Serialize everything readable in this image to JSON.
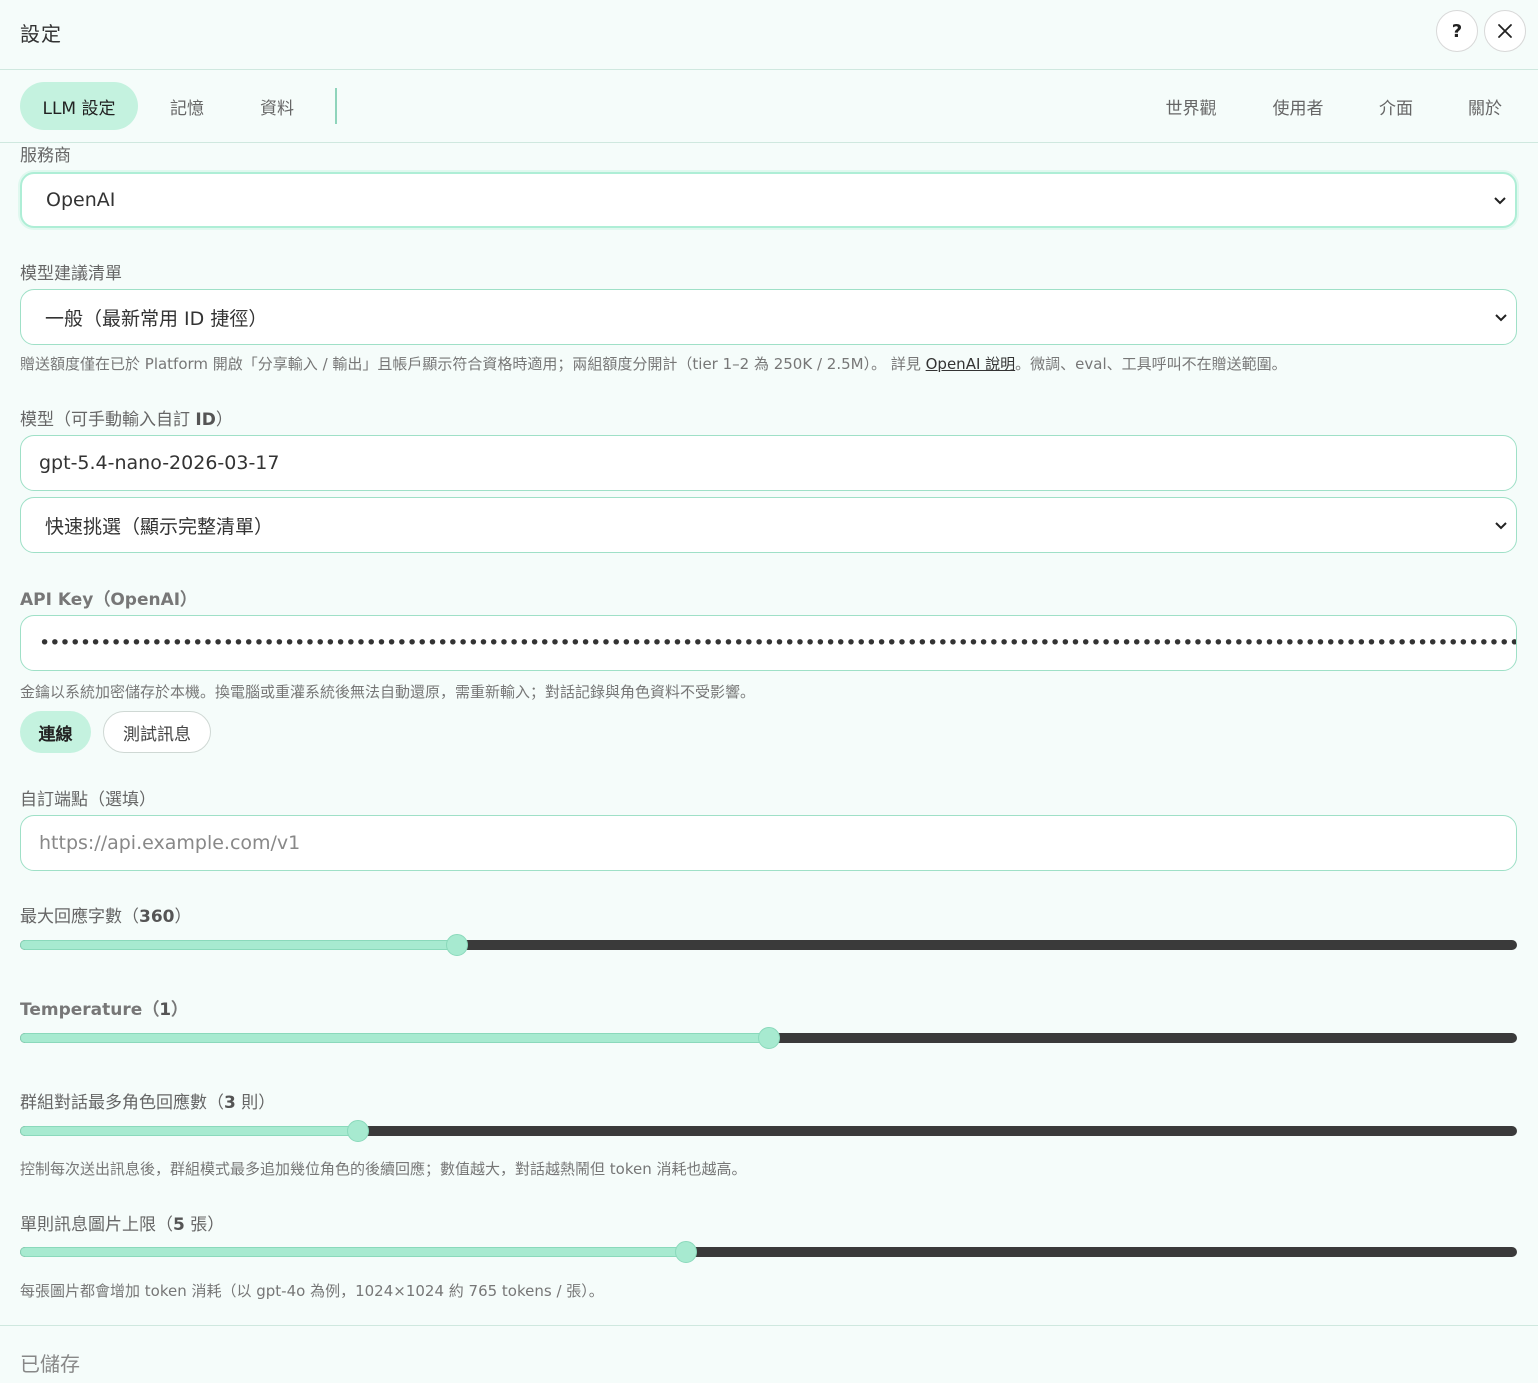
{
  "header": {
    "title": "設定",
    "help_label": "?",
    "close_icon": "close-icon"
  },
  "tabs": {
    "left": [
      {
        "label": "LLM 設定",
        "active": true
      },
      {
        "label": "記憶",
        "active": false
      },
      {
        "label": "資料",
        "active": false
      }
    ],
    "right": [
      {
        "label": "世界觀"
      },
      {
        "label": "使用者"
      },
      {
        "label": "介面"
      },
      {
        "label": "關於"
      }
    ]
  },
  "provider": {
    "label": "服務商",
    "value": "OpenAI"
  },
  "model_list": {
    "label": "模型建議清單",
    "value": "一般（最新常用 ID 捷徑）",
    "help_before": "贈送額度僅在已於 Platform 開啟「分享輸入 / 輸出」且帳戶顯示符合資格時適用；兩組額度分開計（tier 1–2 為 250K / 2.5M）。 詳見 ",
    "help_link": "OpenAI 說明",
    "help_after": "。微調、eval、工具呼叫不在贈送範圍。"
  },
  "model": {
    "label_prefix": "模型（可手動輸入自訂 ",
    "label_bold": "ID",
    "label_suffix": "）",
    "value": "gpt-5.4-nano-2026-03-17",
    "quick_pick": "快速挑選（顯示完整清單）"
  },
  "api_key": {
    "label": "API Key（OpenAI）",
    "masked_value": "••••••••••••••••••••••••••••••••••••••••••••••••••••••••••••••••••••••••••••••••••••••••••••••••••••••••••••••••••••••••••••••••••••••••••••••••••••••••••••••",
    "help": "金鑰以系統加密儲存於本機。換電腦或重灌系統後無法自動還原，需重新輸入；對話記錄與角色資料不受影響。",
    "connect_label": "連線",
    "test_label": "測試訊息"
  },
  "endpoint": {
    "label": "自訂端點（選填）",
    "placeholder": "https://api.example.com/v1"
  },
  "max_chars": {
    "label_prefix": "最大回應字數（",
    "value_text": "360",
    "label_suffix": "）",
    "fraction": 0.292
  },
  "temperature": {
    "label_prefix": "Temperature（",
    "value_text": "1",
    "label_suffix": "）",
    "fraction": 0.5
  },
  "group_replies": {
    "label_prefix": "群組對話最多角色回應數（",
    "value_text": "3",
    "label_suffix": " 則）",
    "fraction": 0.226,
    "help": "控制每次送出訊息後，群組模式最多追加幾位角色的後續回應；數值越大，對話越熱鬧但 token 消耗也越高。"
  },
  "image_limit": {
    "label_prefix": "單則訊息圖片上限（",
    "value_text": "5",
    "label_suffix": " 張）",
    "fraction": 0.445,
    "help": "每張圖片都會增加 token 消耗（以 gpt-4o 為例，1024×1024 約 765 tokens / 張）。"
  },
  "footer": {
    "status": "已儲存"
  },
  "colors": {
    "accent": "#c4f2df",
    "slider_fill": "#a7ead0",
    "slider_track": "#3a3a3a",
    "background": "#f5fcfa"
  }
}
